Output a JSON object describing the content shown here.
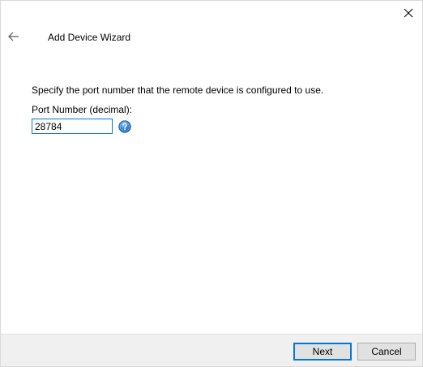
{
  "window": {
    "title": "Add Device Wizard",
    "close_icon": "close-icon",
    "back_icon": "back-arrow-icon"
  },
  "content": {
    "instruction": "Specify the port number that the remote device is configured to use.",
    "port_label": "Port Number (decimal):",
    "port_value": "28784",
    "help_icon": "help-question-icon"
  },
  "footer": {
    "next_label": "Next",
    "cancel_label": "Cancel"
  },
  "colors": {
    "accent": "#0078d7",
    "footer_bg": "#f0f0f0",
    "button_bg": "#e1e1e1"
  }
}
